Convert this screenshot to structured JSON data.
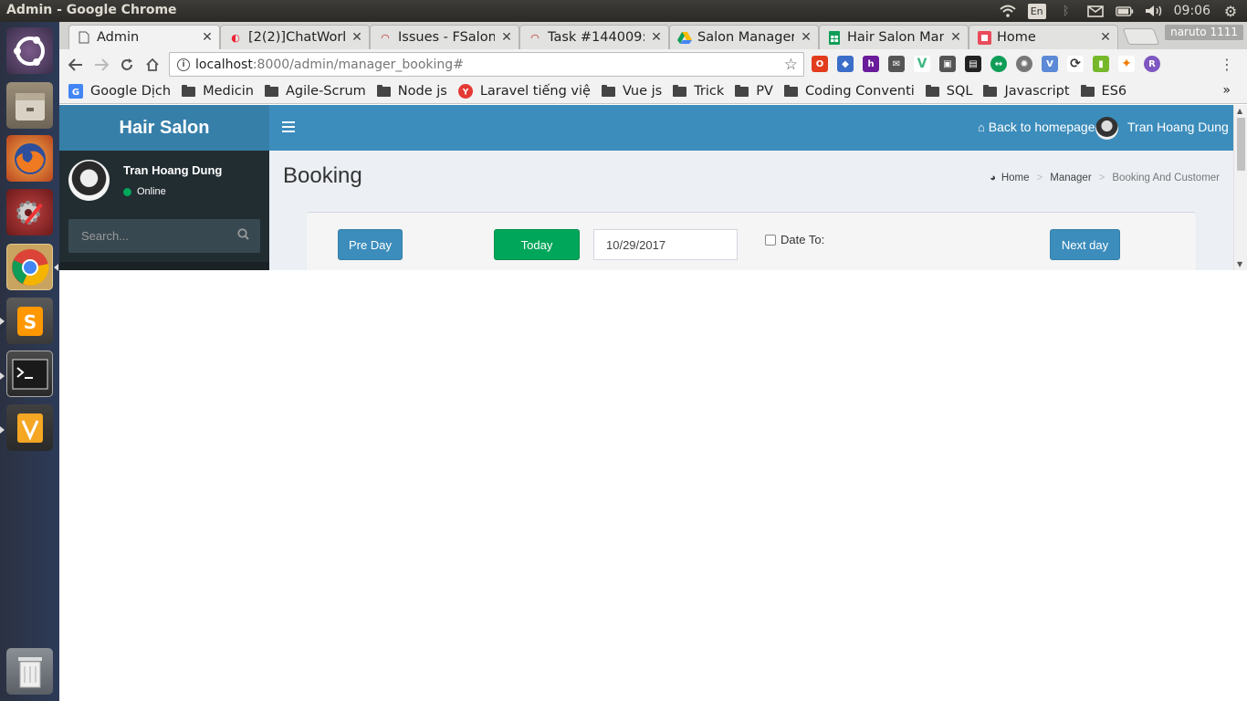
{
  "os": {
    "window_title": "Admin - Google Chrome",
    "language": "En",
    "clock": "09:06"
  },
  "launcher": [
    "ubuntu-dash-icon",
    "files-icon",
    "firefox-icon",
    "system-settings-icon",
    "chrome-icon",
    "sublime-text-icon",
    "terminal-icon",
    "vscode-icon",
    "trash-icon"
  ],
  "browser": {
    "tabs": [
      {
        "label": "Admin",
        "active": true
      },
      {
        "label": "[2(2)]ChatWork"
      },
      {
        "label": "Issues - FSalon"
      },
      {
        "label": "Task #144009: L"
      },
      {
        "label": "Salon Manager"
      },
      {
        "label": "Hair Salon Man"
      },
      {
        "label": "Home"
      }
    ],
    "profile": "naruto 1111",
    "url_host": "localhost",
    "url_path": ":8000/admin/manager_booking#",
    "bookmarks": [
      "Google Dịch",
      "Medicin",
      "Agile-Scrum",
      "Node js",
      "Laravel tiếng việ",
      "Vue js",
      "Trick",
      "PV",
      "Coding Conventi",
      "SQL",
      "Javascript",
      "ES6"
    ],
    "more": "»"
  },
  "app": {
    "brand": "Hair Salon",
    "back_link": "Back to homepage",
    "user_name": "Tran Hoang Dung",
    "user_status": "Online",
    "search_placeholder": "Search...",
    "page_title": "Booking",
    "breadcrumb": [
      "Home",
      "Manager",
      "Booking And Customer"
    ],
    "buttons": {
      "pre_day": "Pre Day",
      "today": "Today",
      "next_day": "Next day"
    },
    "date_value": "10/29/2017",
    "date_to_label": "Date To:"
  },
  "colors": {
    "navbar": "#3c8dbc",
    "logo": "#367fa9",
    "sidebar": "#222d32",
    "success": "#00a65a"
  }
}
